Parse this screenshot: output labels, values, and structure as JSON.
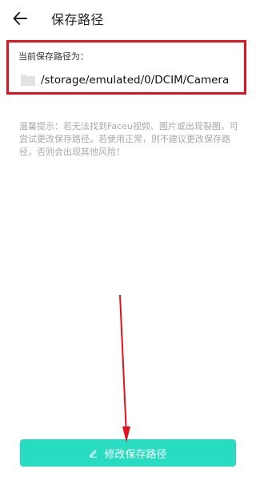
{
  "header": {
    "title": "保存路径",
    "back_icon": "arrow-left-icon"
  },
  "current_path": {
    "label": "当前保存路径为：",
    "icon": "folder-icon",
    "value": "/storage/emulated/0/DCIM/Camera"
  },
  "tip": {
    "text": "温馨提示：若无法找到Faceu视频、图片或出现裂图，可尝试更改保存路径。若使用正常，则不建议更改保存路径，否则会出现其他风险！"
  },
  "action": {
    "icon": "pencil-icon",
    "label": "修改保存路径"
  },
  "colors": {
    "accent": "#27dcc0",
    "highlight": "#e0131f",
    "tip_text": "#a8a8a8"
  }
}
